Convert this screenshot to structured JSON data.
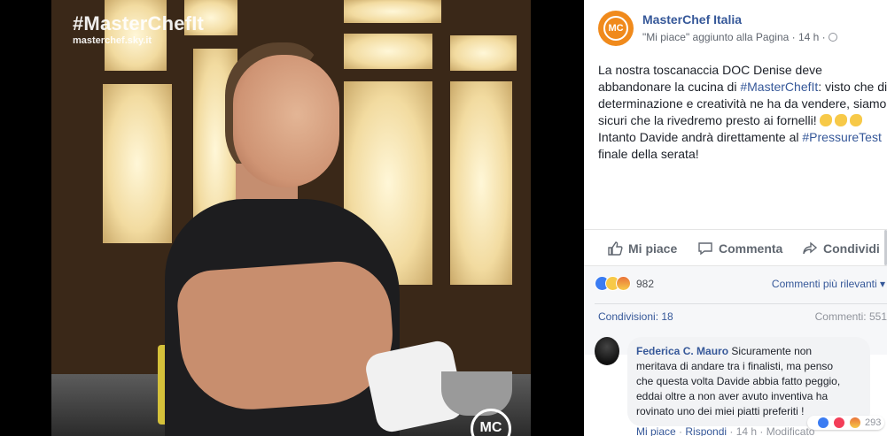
{
  "photo": {
    "hashtag": "#MasterChefIt",
    "site": "masterchef.sky.it",
    "logo": "MC"
  },
  "header": {
    "avatar_text": "MC",
    "page_name": "MasterChef Italia",
    "meta": "\"Mi piace\" aggiunto alla Pagina · 14 h ·",
    "audience_icon": "globe-icon"
  },
  "post": {
    "line1": "La nostra toscanaccia DOC Denise deve",
    "line2a": "abbandonare la cucina di ",
    "line2_tag": "#MasterChefIt",
    "line2b": ": visto che di",
    "line3": "determinazione e creatività ne ha da vendere, siamo",
    "line4": "sicuri che la rivedremo presto ai fornelli!",
    "line5a": "Intanto Davide andrà direttamente al ",
    "line5_tag": "#PressureTest",
    "line6": "finale della serata!",
    "emoji": "clapping-hands-icon"
  },
  "actions": {
    "like": "Mi piace",
    "comment": "Commenta",
    "share": "Condividi"
  },
  "stats": {
    "reaction_count": "982",
    "sort_label": "Commenti più rilevanti ▾",
    "shares": "Condivisioni: 18",
    "comments": "Commenti: 551"
  },
  "comment": {
    "author": "Federica C. Mauro",
    "text1": " Sicuramente non",
    "text2": "meritava di andare tra i finalisti, ma penso",
    "text3": "che questa volta Davide abbia fatto peggio,",
    "text4": "eddai oltre a non aver avuto inventiva ha",
    "text5": "rovinato uno dei miei piatti preferiti !",
    "reaction_count": "293",
    "like_link": "Mi piace",
    "reply_link": "Rispondi",
    "time": "14 h",
    "edited": "Modificato"
  },
  "colors": {
    "link": "#365899",
    "brand": "#f08a1c",
    "like_blue": "#3b7cf2"
  }
}
